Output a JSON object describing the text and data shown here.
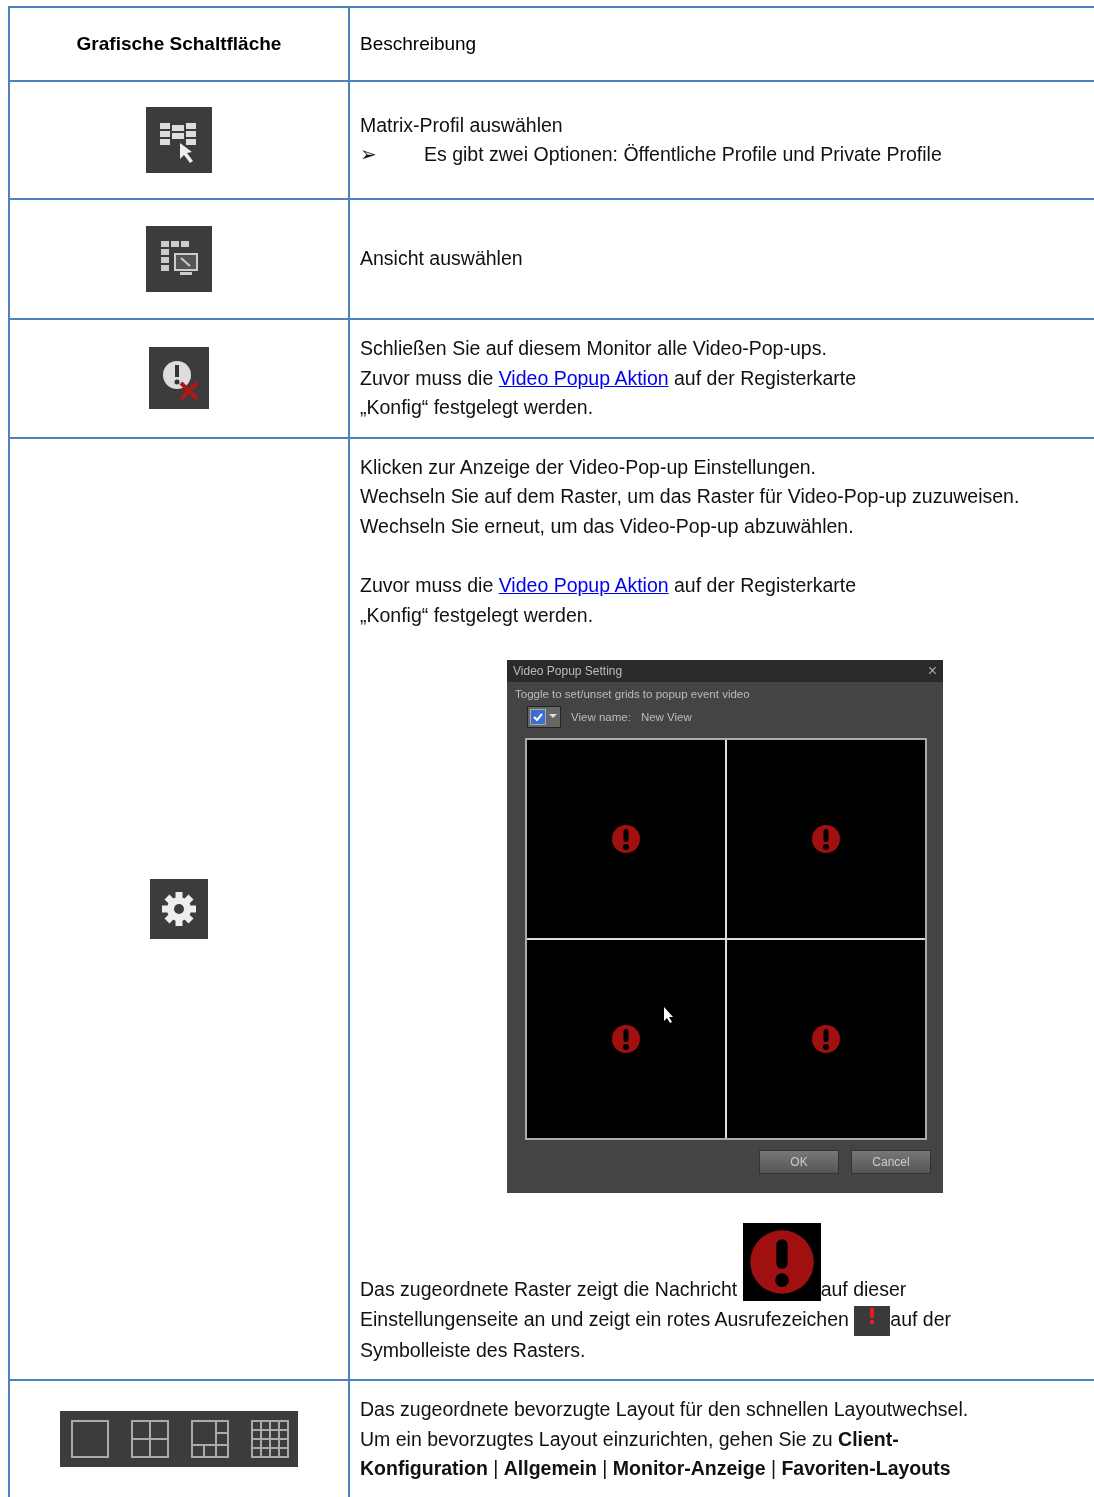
{
  "table": {
    "columns": [
      "Grafische Schaltfläche",
      "Beschreibung"
    ],
    "rows": [
      {
        "kind": "matrix",
        "blocks": [
          {
            "kind": "text",
            "lines": [
              [
                {
                  "kind": "text",
                  "text": "Matrix-Profil auswählen"
                }
              ],
              [
                {
                  "kind": "bullet",
                  "marker": "➢",
                  "text": "Es gibt zwei Optionen: Öffentliche Profile und Private Profile"
                }
              ]
            ]
          }
        ]
      },
      {
        "kind": "view",
        "blocks": [
          {
            "kind": "text",
            "lines": [
              [
                {
                  "kind": "text",
                  "text": "Ansicht auswählen"
                }
              ]
            ]
          }
        ]
      },
      {
        "kind": "close-popups",
        "blocks": [
          {
            "kind": "text",
            "lines": [
              [
                {
                  "kind": "text",
                  "text": "Schließen Sie auf diesem Monitor alle Video-Pop-ups."
                }
              ],
              [
                {
                  "kind": "text",
                  "text": "Zuvor muss die "
                },
                {
                  "kind": "link",
                  "text": "Video Popup Aktion"
                },
                {
                  "kind": "text",
                  "text": " auf der Registerkarte"
                }
              ],
              [
                {
                  "kind": "text",
                  "text": "„Konfig“ festgelegt werden."
                }
              ]
            ]
          }
        ]
      },
      {
        "kind": "settings",
        "blocks": [
          {
            "kind": "text",
            "lines": [
              [
                {
                  "kind": "text",
                  "text": "Klicken zur Anzeige der Video-Pop-up Einstellungen."
                }
              ],
              [
                {
                  "kind": "text",
                  "text": "Wechseln Sie auf dem Raster, um das Raster für Video-Pop-up zuzuweisen."
                }
              ],
              [
                {
                  "kind": "text",
                  "text": "Wechseln Sie erneut, um das Video-Pop-up abzuwählen."
                }
              ]
            ]
          },
          {
            "kind": "text",
            "lines": [
              [
                {
                  "kind": "text",
                  "text": "Zuvor muss die "
                },
                {
                  "kind": "link",
                  "text": "Video Popup Aktion"
                },
                {
                  "kind": "text",
                  "text": " auf der Registerkarte"
                }
              ],
              [
                {
                  "kind": "text",
                  "text": "„Konfig“ festgelegt werden."
                }
              ]
            ]
          },
          {
            "kind": "dialog",
            "title": "Video Popup Setting",
            "close": "×",
            "hint": "Toggle to set/unset grids to popup event video",
            "checked": true,
            "view_label": "View name:",
            "view_name": "New View",
            "buttons": [
              "OK",
              "Cancel"
            ]
          },
          {
            "kind": "text",
            "lines": [
              [
                {
                  "kind": "text",
                  "text": "Das zugeordnete Raster zeigt die Nachricht "
                },
                {
                  "kind": "alert-large"
                },
                {
                  "kind": "text",
                  "text": "auf dieser"
                }
              ],
              [
                {
                  "kind": "text",
                  "text": "Einstellungenseite an und zeigt ein rotes Ausrufezeichen "
                },
                {
                  "kind": "alert-small"
                },
                {
                  "kind": "text",
                  "text": "auf der"
                }
              ],
              [
                {
                  "kind": "text",
                  "text": "Symbolleiste des Rasters."
                }
              ]
            ]
          }
        ]
      },
      {
        "kind": "layouts",
        "blocks": [
          {
            "kind": "text",
            "lines": [
              [
                {
                  "kind": "text",
                  "text": "Das zugeordnete bevorzugte Layout für den schnellen Layoutwechsel."
                }
              ],
              [
                {
                  "kind": "text",
                  "text": "Um ein bevorzugtes Layout einzurichten, gehen Sie zu **Client-**"
                }
              ],
              [
                {
                  "kind": "text",
                  "text": "**Konfiguration** | **Allgemein** | **Monitor-Anzeige** | **Favoriten-Layouts**"
                }
              ]
            ]
          }
        ]
      }
    ]
  }
}
